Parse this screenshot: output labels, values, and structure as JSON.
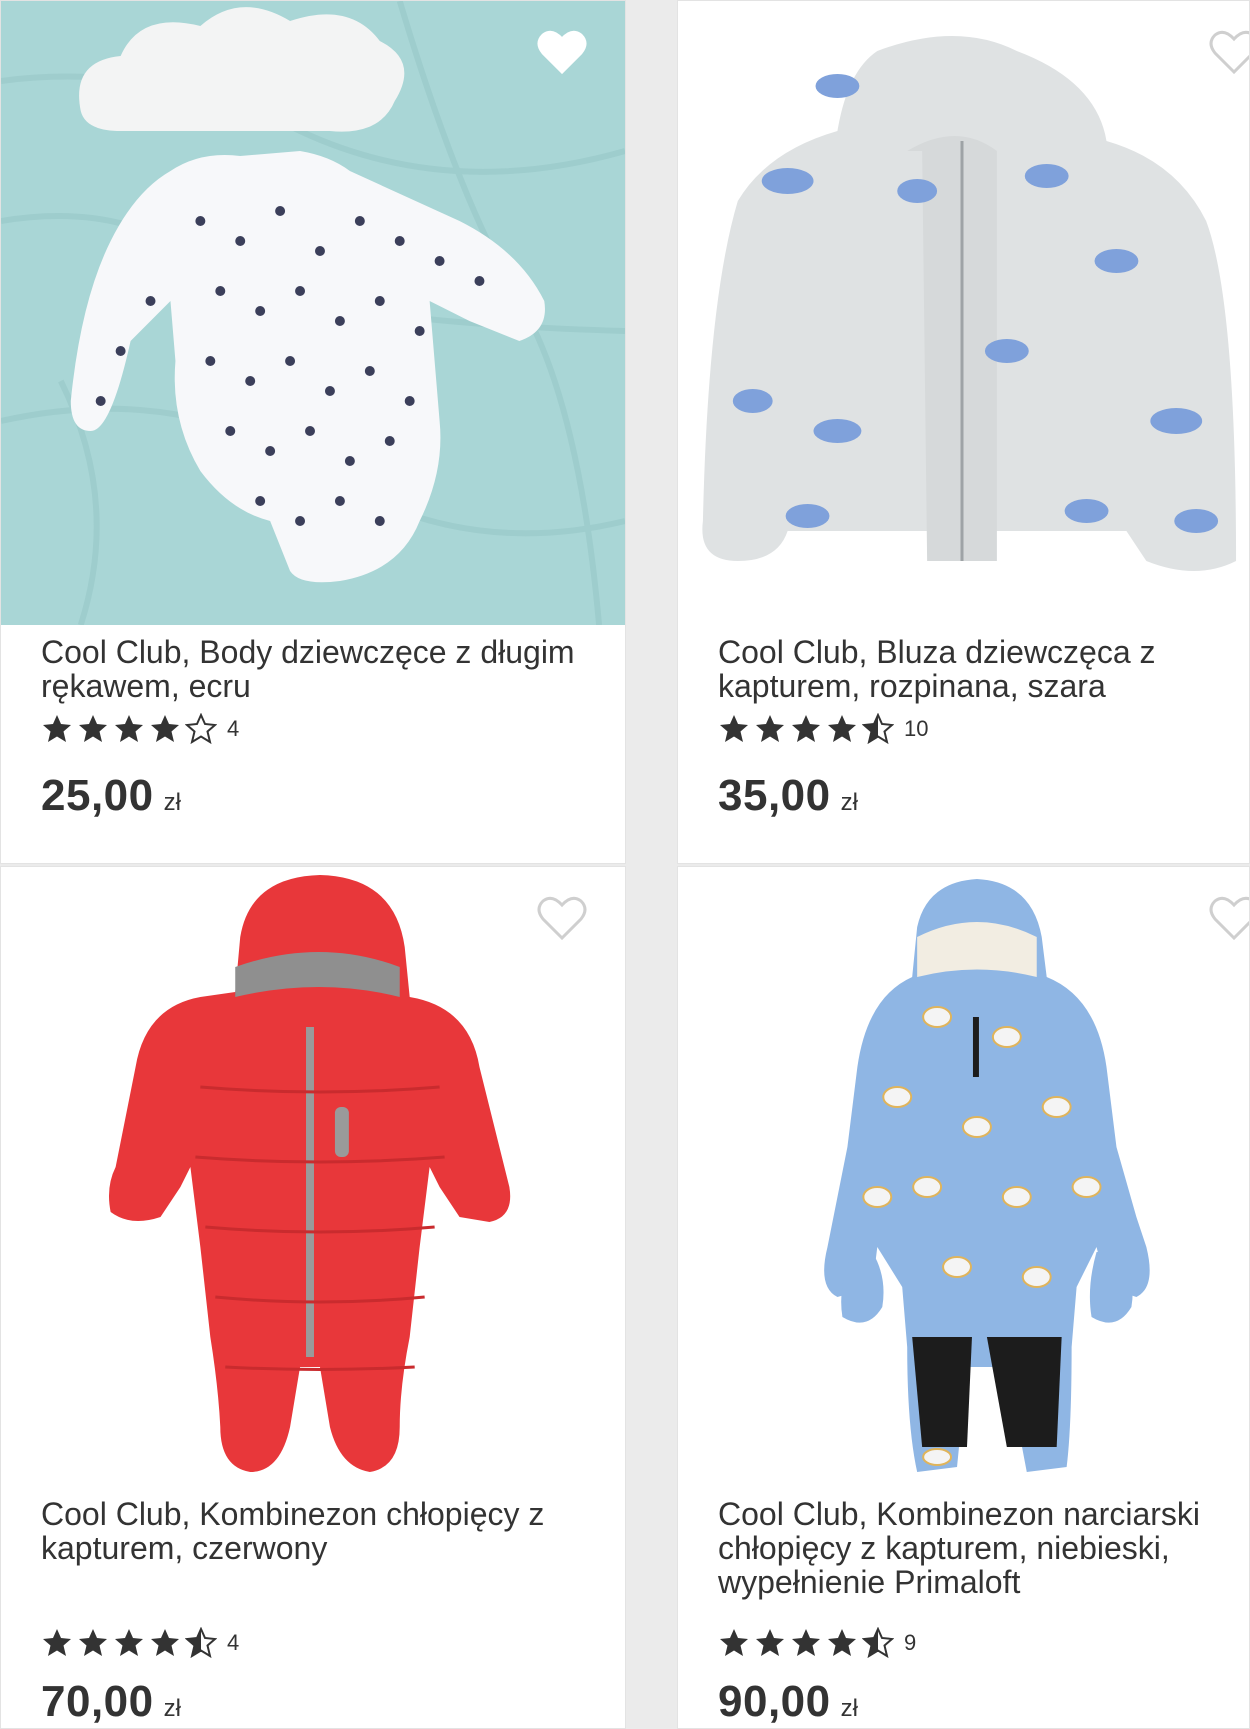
{
  "products": [
    {
      "title": "Cool Club, Body dziewczęce z długim rękawem, ecru",
      "rating": 4,
      "reviews": "4",
      "price": "25,00",
      "currency": "zł",
      "favorited": true,
      "image_icon": "baby-bodysuit"
    },
    {
      "title": "Cool Club, Bluza dziewczęca z kapturem, rozpinana, szara",
      "rating": 4.5,
      "reviews": "10",
      "price": "35,00",
      "currency": "zł",
      "favorited": false,
      "image_icon": "hoodie"
    },
    {
      "title": "Cool Club, Kombinezon chłopięcy z kapturem, czerwony",
      "rating": 4.5,
      "reviews": "4",
      "price": "70,00",
      "currency": "zł",
      "favorited": false,
      "image_icon": "snowsuit-red"
    },
    {
      "title": "Cool Club, Kombinezon narciarski chłopięcy z kapturem, niebieski, wypełnienie Primaloft",
      "rating": 4.5,
      "reviews": "9",
      "price": "90,00",
      "currency": "zł",
      "favorited": false,
      "image_icon": "ski-suit-blue"
    }
  ],
  "colors": {
    "background": "#ebebeb",
    "text": "#333333",
    "star": "#333333"
  }
}
